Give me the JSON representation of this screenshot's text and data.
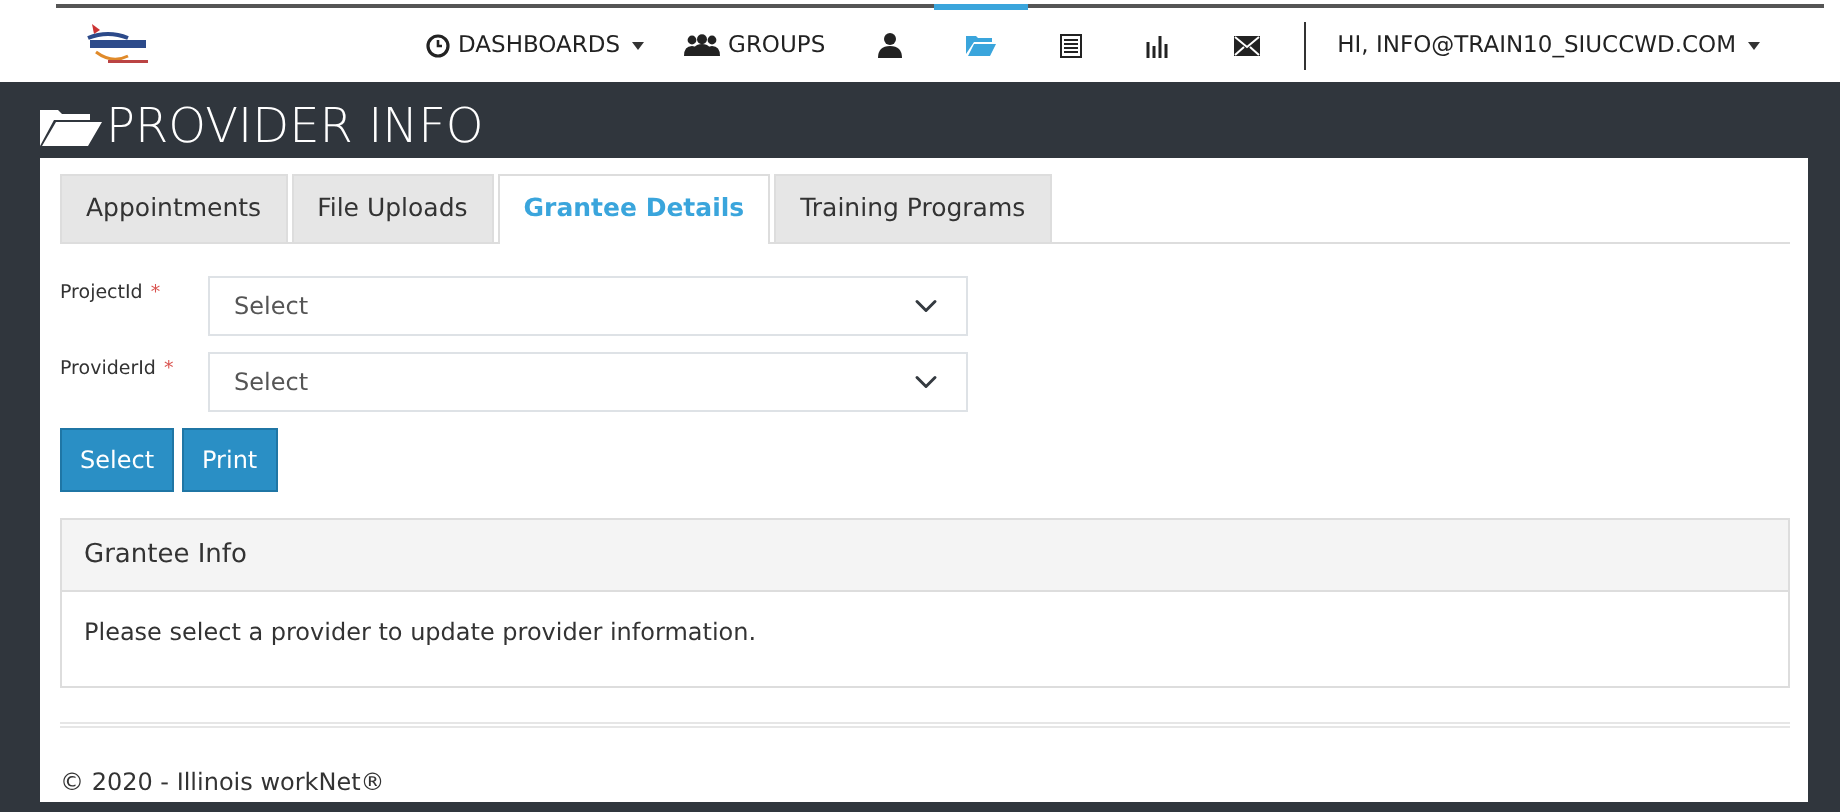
{
  "navbar": {
    "items": [
      {
        "kind": "dropdown",
        "label": "DASHBOARDS",
        "selected": false
      },
      {
        "kind": "link",
        "label": "GROUPS",
        "selected": false
      },
      {
        "kind": "icon",
        "selected": false
      },
      {
        "kind": "icon",
        "selected": true
      },
      {
        "kind": "icon",
        "selected": false
      },
      {
        "kind": "icon",
        "selected": false
      },
      {
        "kind": "icon",
        "selected": false
      }
    ],
    "user_menu": "HI, INFO@TRAIN10_SIUCCWD.COM"
  },
  "page_title": "PROVIDER INFO",
  "tabs": [
    {
      "label": "Appointments",
      "selected": false
    },
    {
      "label": "File Uploads",
      "selected": false
    },
    {
      "label": "Grantee Details",
      "selected": true
    },
    {
      "label": "Training Programs",
      "selected": false
    }
  ],
  "fields": [
    {
      "label": "ProjectId",
      "required_marker": "*",
      "value": "Select"
    },
    {
      "label": "ProviderId",
      "required_marker": "*",
      "value": "Select"
    }
  ],
  "buttons": [
    "Select",
    "Print"
  ],
  "panel": {
    "heading": "Grantee Info",
    "body": "Please select a provider to update provider information."
  },
  "footer": "© 2020 - Illinois workNet®"
}
